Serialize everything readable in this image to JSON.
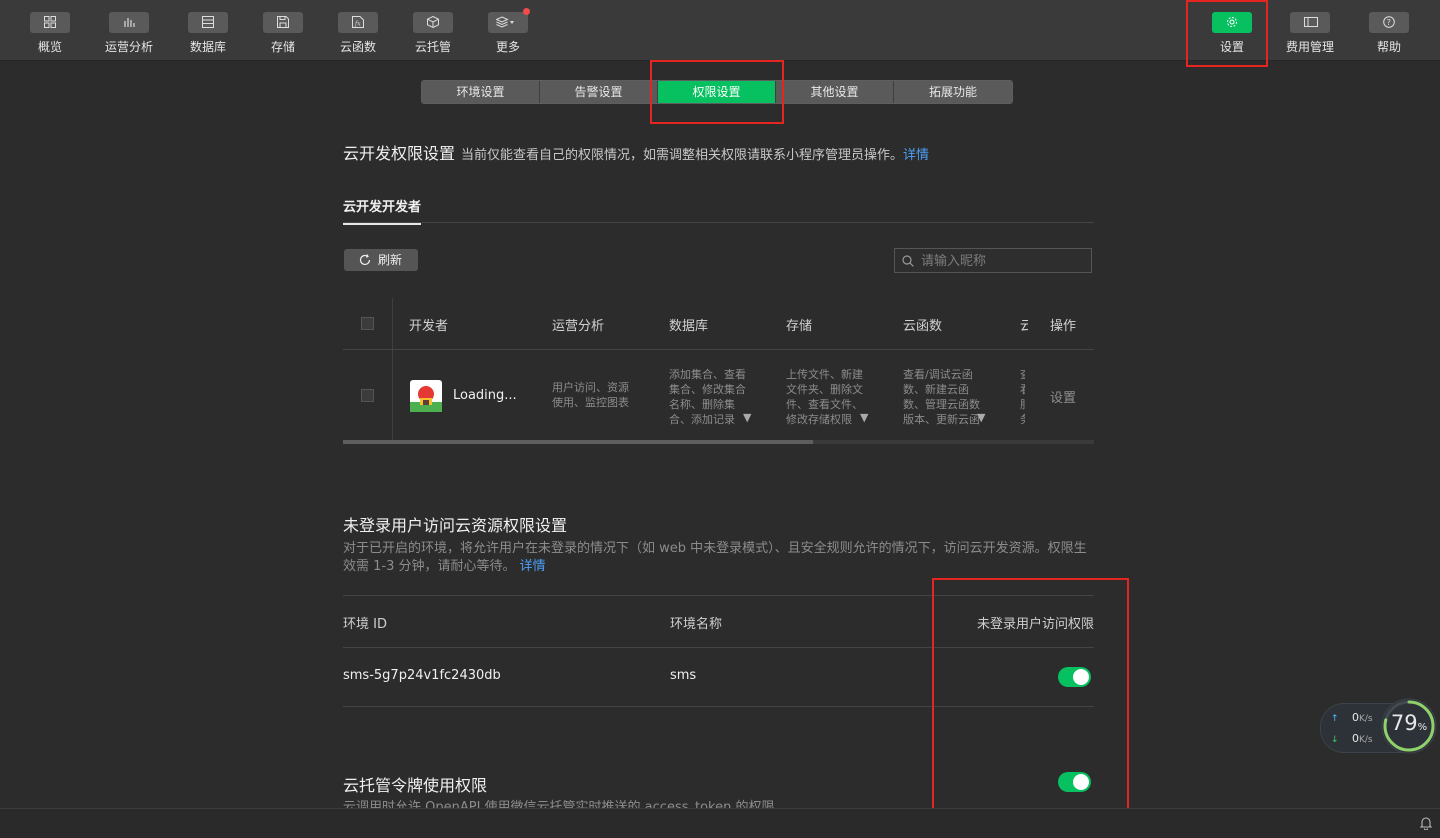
{
  "toolbar": {
    "left_items": [
      {
        "label": "概览",
        "icon": "grid-icon"
      },
      {
        "label": "运营分析",
        "icon": "bar-chart-icon"
      },
      {
        "label": "数据库",
        "icon": "database-icon"
      },
      {
        "label": "存储",
        "icon": "floppy-disk-icon"
      },
      {
        "label": "云函数",
        "icon": "function-icon"
      },
      {
        "label": "云托管",
        "icon": "cube-icon"
      },
      {
        "label": "更多",
        "icon": "layers-icon"
      }
    ],
    "right_items": [
      {
        "label": "设置",
        "icon": "gear-icon",
        "active": true
      },
      {
        "label": "费用管理",
        "icon": "ticket-icon"
      },
      {
        "label": "帮助",
        "icon": "question-icon"
      }
    ]
  },
  "tabs": [
    "环境设置",
    "告警设置",
    "权限设置",
    "其他设置",
    "拓展功能"
  ],
  "active_tab": "权限设置",
  "permissions": {
    "title": "云开发权限设置",
    "description": "当前仅能查看自己的权限情况，如需调整相关权限请联系小程序管理员操作。",
    "detail_link": "详情",
    "subtab": "云开发开发者",
    "refresh_label": "刷新",
    "search_placeholder": "请输入昵称"
  },
  "developer_table": {
    "columns": [
      "开发者",
      "运营分析",
      "数据库",
      "存储",
      "云函数",
      "云托管",
      "操作"
    ],
    "rows": [
      {
        "name": "Loading...",
        "analytics": "用户访问、资源使用、监控图表",
        "database": "添加集合、查看集合、修改集合名称、删除集合、添加记录",
        "storage": "上传文件、新建文件夹、删除文件、查看文件、修改存储权限",
        "functions": "查看/调试云函数、新建云函数、管理云函数版本、更新云函数",
        "hosting": "查看服务、管理版本",
        "action": "设置"
      }
    ]
  },
  "anonymous": {
    "title": "未登录用户访问云资源权限设置",
    "description": "对于已开启的环境，将允许用户在未登录的情况下（如 web 中未登录模式）、且安全规则允许的情况下，访问云开发资源。权限生效需 1-3 分钟，请耐心等待。",
    "detail_link": "详情",
    "columns": [
      "环境 ID",
      "环境名称",
      "未登录用户访问权限"
    ],
    "rows": [
      {
        "env_id": "sms-5g7p24v1fc2430db",
        "env_name": "sms",
        "enabled": true
      }
    ]
  },
  "token": {
    "title": "云托管令牌使用权限",
    "description": "云调用时允许 OpenAPI 使用微信云托管实时推送的 access_token 的权限",
    "enabled": true
  },
  "network_widget": {
    "upload_speed": "0",
    "download_speed": "0",
    "unit": "K/s",
    "percent": "79",
    "percent_sign": "%"
  },
  "colors": {
    "accent": "#07c160",
    "link": "#4c9ef6",
    "highlight_box": "#e5251f"
  }
}
